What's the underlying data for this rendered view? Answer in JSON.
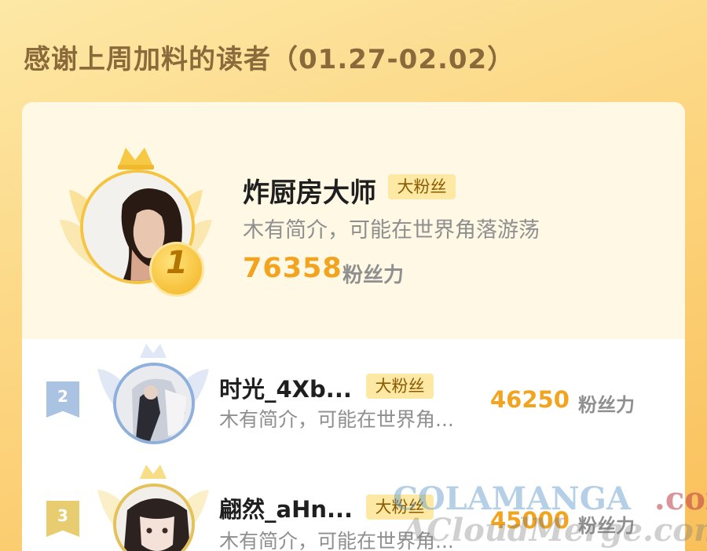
{
  "header": {
    "title": "感谢上周加料的读者（01.27-02.02）"
  },
  "ranking": [
    {
      "rank": "1",
      "name": "炸厨房大师",
      "badge": "大粉丝",
      "intro": "木有简介，可能在世界角落游荡",
      "score": "76358",
      "unit": "粉丝力"
    },
    {
      "rank": "2",
      "name": "时光_4Xb...",
      "badge": "大粉丝",
      "intro": "木有简介，可能在世界角...",
      "score": "46250",
      "unit": "粉丝力"
    },
    {
      "rank": "3",
      "name": "翩然_aHn...",
      "badge": "大粉丝",
      "intro": "木有简介，可能在世界角...",
      "score": "45000",
      "unit": "粉丝力"
    }
  ],
  "watermark": {
    "line1": "COLAMANGA",
    "line1_suffix": ".com",
    "line2": "ACloudMerge.com"
  },
  "colors": {
    "accent": "#f2a41f",
    "gold": "#f5c542",
    "silver": "#9fb8d8",
    "bronze": "#e7c865"
  }
}
